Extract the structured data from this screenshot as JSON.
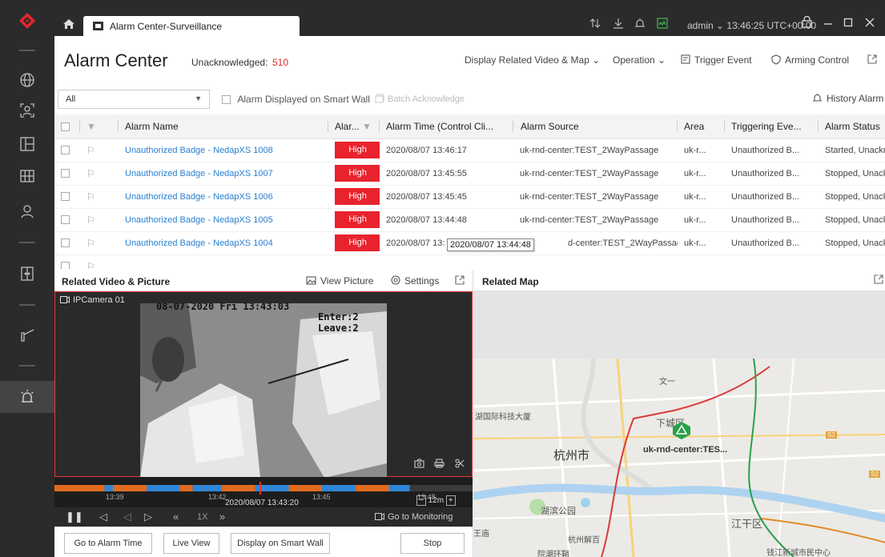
{
  "window": {
    "tab_title": "Alarm Center-Surveillance",
    "user": "admin",
    "time": "13:46:25 UTC+00:00"
  },
  "header": {
    "title": "Alarm Center",
    "unack_label": "Unacknowledged:",
    "unack_count": "510",
    "actions": {
      "display_related": "Display Related Video & Map",
      "operation": "Operation",
      "trigger": "Trigger Event",
      "arming": "Arming Control"
    }
  },
  "filter": {
    "value": "All",
    "smartwall": "Alarm Displayed on Smart Wall",
    "batch": "Batch Acknowledge",
    "history": "History Alarm"
  },
  "table": {
    "columns": [
      "Alarm Name",
      "Alar...",
      "Alarm Time (Control Cli...",
      "Alarm Source",
      "Area",
      "Triggering Eve...",
      "Alarm Status"
    ],
    "rows": [
      {
        "name": "Unauthorized Badge - NedapXS 1008",
        "level": "High",
        "time": "2020/08/07 13:46:17",
        "source": "uk-rnd-center:TEST_2WayPassage",
        "area": "uk-r...",
        "event": "Unauthorized B...",
        "status": "Started, Unackn"
      },
      {
        "name": "Unauthorized Badge - NedapXS 1007",
        "level": "High",
        "time": "2020/08/07 13:45:55",
        "source": "uk-rnd-center:TEST_2WayPassage",
        "area": "uk-r...",
        "event": "Unauthorized B...",
        "status": "Stopped, Unack"
      },
      {
        "name": "Unauthorized Badge - NedapXS 1006",
        "level": "High",
        "time": "2020/08/07 13:45:45",
        "source": "uk-rnd-center:TEST_2WayPassage",
        "area": "uk-r...",
        "event": "Unauthorized B...",
        "status": "Stopped, Unack"
      },
      {
        "name": "Unauthorized Badge - NedapXS 1005",
        "level": "High",
        "time": "2020/08/07 13:44:48",
        "source": "uk-rnd-center:TEST_2WayPassage",
        "area": "uk-r...",
        "event": "Unauthorized B...",
        "status": "Stopped, Unack"
      },
      {
        "name": "Unauthorized Badge - NedapXS 1004",
        "level": "High",
        "time": "2020/08/07 13:",
        "source": "d-center:TEST_2WayPassage",
        "area": "uk-r...",
        "event": "Unauthorized B...",
        "status": "Stopped, Unack"
      }
    ],
    "tooltip": "2020/08/07 13:44:48"
  },
  "video": {
    "title": "Related Video & Picture",
    "view_picture": "View Picture",
    "settings": "Settings",
    "camera": "IPCamera 01",
    "osd_time": "08-07-2020 Fri 13:43:03",
    "osd_enter": "Enter:2",
    "osd_leave": "Leave:2",
    "ticks": [
      "13:39",
      "13:42",
      "13:45",
      "13:48"
    ],
    "current_time": "2020/08/07 13:43:20",
    "zoom": "12m",
    "speed": "1X",
    "goto_monitoring": "Go to Monitoring",
    "buttons": {
      "goto_alarm": "Go to Alarm Time",
      "live_view": "Live View",
      "display_wall": "Display on Smart Wall",
      "stop": "Stop"
    }
  },
  "map": {
    "title": "Related Map",
    "device_label": "uk-rnd-center:TES...",
    "labels": {
      "city": "杭州市",
      "tech": "湖国际科技大厦",
      "park": "湖滨公园",
      "district": "江干区",
      "xiacheng": "下城区",
      "wenli": "文一",
      "jiefang": "杭州解百",
      "qianjiang": "钱江新城市民中心",
      "yuanwang": "院潮环鞘",
      "wangmiao": "王庙"
    },
    "colors": {
      "red_line": "#d83a3a",
      "green_line": "#2aa04a",
      "orange_line": "#e28a2a"
    }
  },
  "colors": {
    "accent_red": "#e8232d",
    "link_blue": "#2a7fd0",
    "sidebar": "#2b2b2b"
  }
}
